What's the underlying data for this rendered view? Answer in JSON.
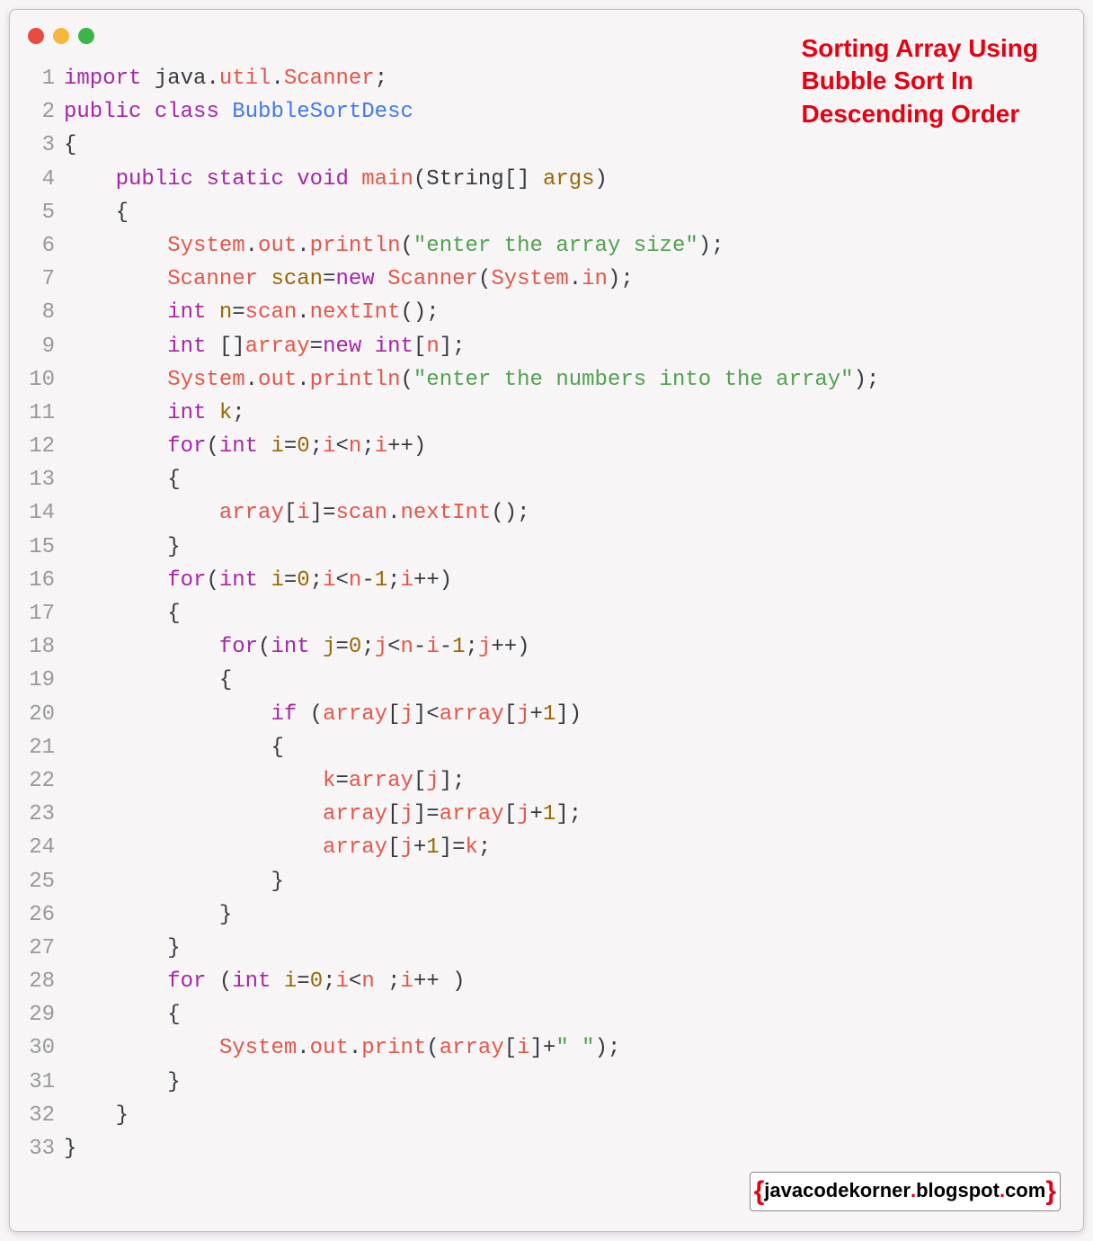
{
  "title": "Sorting Array Using\nBubble Sort In\nDescending Order",
  "footer": {
    "leftBrace": "{",
    "domain": "javacodekorner",
    "dot": ".",
    "suffix": "blogspot",
    "dot2": ".",
    "tld": "com",
    "rightBrace": "}"
  },
  "lines": [
    {
      "num": "1",
      "segments": [
        {
          "c": "kw-purple",
          "t": "import"
        },
        {
          "c": "txt-black",
          "t": " java"
        },
        {
          "c": "punct",
          "t": "."
        },
        {
          "c": "var-red",
          "t": "util"
        },
        {
          "c": "punct",
          "t": "."
        },
        {
          "c": "var-red",
          "t": "Scanner"
        },
        {
          "c": "punct",
          "t": ";"
        }
      ]
    },
    {
      "num": "2",
      "segments": [
        {
          "c": "kw-purple",
          "t": "public"
        },
        {
          "c": "txt-black",
          "t": " "
        },
        {
          "c": "kw-purple",
          "t": "class"
        },
        {
          "c": "txt-black",
          "t": " "
        },
        {
          "c": "cls-name",
          "t": "BubbleSortDesc"
        }
      ]
    },
    {
      "num": "3",
      "segments": [
        {
          "c": "punct",
          "t": "{"
        }
      ]
    },
    {
      "num": "4",
      "segments": [
        {
          "c": "txt-black",
          "t": "    "
        },
        {
          "c": "kw-purple",
          "t": "public"
        },
        {
          "c": "txt-black",
          "t": " "
        },
        {
          "c": "kw-purple",
          "t": "static"
        },
        {
          "c": "txt-black",
          "t": " "
        },
        {
          "c": "kw-purple",
          "t": "void"
        },
        {
          "c": "txt-black",
          "t": " "
        },
        {
          "c": "method-red",
          "t": "main"
        },
        {
          "c": "punct",
          "t": "("
        },
        {
          "c": "txt-black",
          "t": "String"
        },
        {
          "c": "punct",
          "t": "[] "
        },
        {
          "c": "ident",
          "t": "args"
        },
        {
          "c": "punct",
          "t": ")"
        }
      ]
    },
    {
      "num": "5",
      "segments": [
        {
          "c": "txt-black",
          "t": "    "
        },
        {
          "c": "punct",
          "t": "{"
        }
      ]
    },
    {
      "num": "6",
      "segments": [
        {
          "c": "txt-black",
          "t": "        "
        },
        {
          "c": "var-red",
          "t": "System"
        },
        {
          "c": "punct",
          "t": "."
        },
        {
          "c": "var-red",
          "t": "out"
        },
        {
          "c": "punct",
          "t": "."
        },
        {
          "c": "var-red",
          "t": "println"
        },
        {
          "c": "punct",
          "t": "("
        },
        {
          "c": "str-green",
          "t": "\"enter the array size\""
        },
        {
          "c": "punct",
          "t": ");"
        }
      ]
    },
    {
      "num": "7",
      "segments": [
        {
          "c": "txt-black",
          "t": "        "
        },
        {
          "c": "var-red",
          "t": "Scanner"
        },
        {
          "c": "txt-black",
          "t": " "
        },
        {
          "c": "ident",
          "t": "scan"
        },
        {
          "c": "punct",
          "t": "="
        },
        {
          "c": "kw-purple",
          "t": "new"
        },
        {
          "c": "txt-black",
          "t": " "
        },
        {
          "c": "var-red",
          "t": "Scanner"
        },
        {
          "c": "punct",
          "t": "("
        },
        {
          "c": "var-red",
          "t": "System"
        },
        {
          "c": "punct",
          "t": "."
        },
        {
          "c": "var-red",
          "t": "in"
        },
        {
          "c": "punct",
          "t": ");"
        }
      ]
    },
    {
      "num": "8",
      "segments": [
        {
          "c": "txt-black",
          "t": "        "
        },
        {
          "c": "kw-purple",
          "t": "int"
        },
        {
          "c": "txt-black",
          "t": " "
        },
        {
          "c": "ident",
          "t": "n"
        },
        {
          "c": "punct",
          "t": "="
        },
        {
          "c": "var-red",
          "t": "scan"
        },
        {
          "c": "punct",
          "t": "."
        },
        {
          "c": "var-red",
          "t": "nextInt"
        },
        {
          "c": "punct",
          "t": "();"
        }
      ]
    },
    {
      "num": "9",
      "segments": [
        {
          "c": "txt-black",
          "t": "        "
        },
        {
          "c": "kw-purple",
          "t": "int"
        },
        {
          "c": "txt-black",
          "t": " "
        },
        {
          "c": "punct",
          "t": "[]"
        },
        {
          "c": "var-red",
          "t": "array"
        },
        {
          "c": "punct",
          "t": "="
        },
        {
          "c": "kw-purple",
          "t": "new"
        },
        {
          "c": "txt-black",
          "t": " "
        },
        {
          "c": "kw-purple",
          "t": "int"
        },
        {
          "c": "punct",
          "t": "["
        },
        {
          "c": "var-red",
          "t": "n"
        },
        {
          "c": "punct",
          "t": "];"
        }
      ]
    },
    {
      "num": "10",
      "segments": [
        {
          "c": "txt-black",
          "t": "        "
        },
        {
          "c": "var-red",
          "t": "System"
        },
        {
          "c": "punct",
          "t": "."
        },
        {
          "c": "var-red",
          "t": "out"
        },
        {
          "c": "punct",
          "t": "."
        },
        {
          "c": "var-red",
          "t": "println"
        },
        {
          "c": "punct",
          "t": "("
        },
        {
          "c": "str-green",
          "t": "\"enter the numbers into the array\""
        },
        {
          "c": "punct",
          "t": ");"
        }
      ]
    },
    {
      "num": "11",
      "segments": [
        {
          "c": "txt-black",
          "t": "        "
        },
        {
          "c": "kw-purple",
          "t": "int"
        },
        {
          "c": "txt-black",
          "t": " "
        },
        {
          "c": "ident",
          "t": "k"
        },
        {
          "c": "punct",
          "t": ";"
        }
      ]
    },
    {
      "num": "12",
      "segments": [
        {
          "c": "txt-black",
          "t": "        "
        },
        {
          "c": "kw-purple",
          "t": "for"
        },
        {
          "c": "punct",
          "t": "("
        },
        {
          "c": "kw-purple",
          "t": "int"
        },
        {
          "c": "txt-black",
          "t": " "
        },
        {
          "c": "ident",
          "t": "i"
        },
        {
          "c": "punct",
          "t": "="
        },
        {
          "c": "num-orange",
          "t": "0"
        },
        {
          "c": "punct",
          "t": ";"
        },
        {
          "c": "var-red",
          "t": "i"
        },
        {
          "c": "punct",
          "t": "<"
        },
        {
          "c": "var-red",
          "t": "n"
        },
        {
          "c": "punct",
          "t": ";"
        },
        {
          "c": "var-red",
          "t": "i"
        },
        {
          "c": "punct",
          "t": "++)"
        }
      ]
    },
    {
      "num": "13",
      "segments": [
        {
          "c": "txt-black",
          "t": "        "
        },
        {
          "c": "punct",
          "t": "{"
        }
      ]
    },
    {
      "num": "14",
      "segments": [
        {
          "c": "txt-black",
          "t": "            "
        },
        {
          "c": "var-red",
          "t": "array"
        },
        {
          "c": "punct",
          "t": "["
        },
        {
          "c": "var-red",
          "t": "i"
        },
        {
          "c": "punct",
          "t": "]="
        },
        {
          "c": "var-red",
          "t": "scan"
        },
        {
          "c": "punct",
          "t": "."
        },
        {
          "c": "var-red",
          "t": "nextInt"
        },
        {
          "c": "punct",
          "t": "();"
        }
      ]
    },
    {
      "num": "15",
      "segments": [
        {
          "c": "txt-black",
          "t": "        "
        },
        {
          "c": "punct",
          "t": "}"
        }
      ]
    },
    {
      "num": "16",
      "segments": [
        {
          "c": "txt-black",
          "t": "        "
        },
        {
          "c": "kw-purple",
          "t": "for"
        },
        {
          "c": "punct",
          "t": "("
        },
        {
          "c": "kw-purple",
          "t": "int"
        },
        {
          "c": "txt-black",
          "t": " "
        },
        {
          "c": "ident",
          "t": "i"
        },
        {
          "c": "punct",
          "t": "="
        },
        {
          "c": "num-orange",
          "t": "0"
        },
        {
          "c": "punct",
          "t": ";"
        },
        {
          "c": "var-red",
          "t": "i"
        },
        {
          "c": "punct",
          "t": "<"
        },
        {
          "c": "var-red",
          "t": "n"
        },
        {
          "c": "punct",
          "t": "-"
        },
        {
          "c": "num-orange",
          "t": "1"
        },
        {
          "c": "punct",
          "t": ";"
        },
        {
          "c": "var-red",
          "t": "i"
        },
        {
          "c": "punct",
          "t": "++)"
        }
      ]
    },
    {
      "num": "17",
      "segments": [
        {
          "c": "txt-black",
          "t": "        "
        },
        {
          "c": "punct",
          "t": "{"
        }
      ]
    },
    {
      "num": "18",
      "segments": [
        {
          "c": "txt-black",
          "t": "            "
        },
        {
          "c": "kw-purple",
          "t": "for"
        },
        {
          "c": "punct",
          "t": "("
        },
        {
          "c": "kw-purple",
          "t": "int"
        },
        {
          "c": "txt-black",
          "t": " "
        },
        {
          "c": "ident",
          "t": "j"
        },
        {
          "c": "punct",
          "t": "="
        },
        {
          "c": "num-orange",
          "t": "0"
        },
        {
          "c": "punct",
          "t": ";"
        },
        {
          "c": "var-red",
          "t": "j"
        },
        {
          "c": "punct",
          "t": "<"
        },
        {
          "c": "var-red",
          "t": "n"
        },
        {
          "c": "punct",
          "t": "-"
        },
        {
          "c": "var-red",
          "t": "i"
        },
        {
          "c": "punct",
          "t": "-"
        },
        {
          "c": "num-orange",
          "t": "1"
        },
        {
          "c": "punct",
          "t": ";"
        },
        {
          "c": "var-red",
          "t": "j"
        },
        {
          "c": "punct",
          "t": "++)"
        }
      ]
    },
    {
      "num": "19",
      "segments": [
        {
          "c": "txt-black",
          "t": "            "
        },
        {
          "c": "punct",
          "t": "{"
        }
      ]
    },
    {
      "num": "20",
      "segments": [
        {
          "c": "txt-black",
          "t": "                "
        },
        {
          "c": "kw-purple",
          "t": "if"
        },
        {
          "c": "txt-black",
          "t": " "
        },
        {
          "c": "punct",
          "t": "("
        },
        {
          "c": "var-red",
          "t": "array"
        },
        {
          "c": "punct",
          "t": "["
        },
        {
          "c": "var-red",
          "t": "j"
        },
        {
          "c": "punct",
          "t": "]<"
        },
        {
          "c": "var-red",
          "t": "array"
        },
        {
          "c": "punct",
          "t": "["
        },
        {
          "c": "var-red",
          "t": "j"
        },
        {
          "c": "punct",
          "t": "+"
        },
        {
          "c": "num-orange",
          "t": "1"
        },
        {
          "c": "punct",
          "t": "])"
        }
      ]
    },
    {
      "num": "21",
      "segments": [
        {
          "c": "txt-black",
          "t": "                "
        },
        {
          "c": "punct",
          "t": "{"
        }
      ]
    },
    {
      "num": "22",
      "segments": [
        {
          "c": "txt-black",
          "t": "                    "
        },
        {
          "c": "var-red",
          "t": "k"
        },
        {
          "c": "punct",
          "t": "="
        },
        {
          "c": "var-red",
          "t": "array"
        },
        {
          "c": "punct",
          "t": "["
        },
        {
          "c": "var-red",
          "t": "j"
        },
        {
          "c": "punct",
          "t": "];"
        }
      ]
    },
    {
      "num": "23",
      "segments": [
        {
          "c": "txt-black",
          "t": "                    "
        },
        {
          "c": "var-red",
          "t": "array"
        },
        {
          "c": "punct",
          "t": "["
        },
        {
          "c": "var-red",
          "t": "j"
        },
        {
          "c": "punct",
          "t": "]="
        },
        {
          "c": "var-red",
          "t": "array"
        },
        {
          "c": "punct",
          "t": "["
        },
        {
          "c": "var-red",
          "t": "j"
        },
        {
          "c": "punct",
          "t": "+"
        },
        {
          "c": "num-orange",
          "t": "1"
        },
        {
          "c": "punct",
          "t": "];"
        }
      ]
    },
    {
      "num": "24",
      "segments": [
        {
          "c": "txt-black",
          "t": "                    "
        },
        {
          "c": "var-red",
          "t": "array"
        },
        {
          "c": "punct",
          "t": "["
        },
        {
          "c": "var-red",
          "t": "j"
        },
        {
          "c": "punct",
          "t": "+"
        },
        {
          "c": "num-orange",
          "t": "1"
        },
        {
          "c": "punct",
          "t": "]="
        },
        {
          "c": "var-red",
          "t": "k"
        },
        {
          "c": "punct",
          "t": ";"
        }
      ]
    },
    {
      "num": "25",
      "segments": [
        {
          "c": "txt-black",
          "t": "                "
        },
        {
          "c": "punct",
          "t": "}"
        }
      ]
    },
    {
      "num": "26",
      "segments": [
        {
          "c": "txt-black",
          "t": "            "
        },
        {
          "c": "punct",
          "t": "}"
        }
      ]
    },
    {
      "num": "27",
      "segments": [
        {
          "c": "txt-black",
          "t": "        "
        },
        {
          "c": "punct",
          "t": "}"
        }
      ]
    },
    {
      "num": "28",
      "segments": [
        {
          "c": "txt-black",
          "t": "        "
        },
        {
          "c": "kw-purple",
          "t": "for"
        },
        {
          "c": "txt-black",
          "t": " "
        },
        {
          "c": "punct",
          "t": "("
        },
        {
          "c": "kw-purple",
          "t": "int"
        },
        {
          "c": "txt-black",
          "t": " "
        },
        {
          "c": "ident",
          "t": "i"
        },
        {
          "c": "punct",
          "t": "="
        },
        {
          "c": "num-orange",
          "t": "0"
        },
        {
          "c": "punct",
          "t": ";"
        },
        {
          "c": "var-red",
          "t": "i"
        },
        {
          "c": "punct",
          "t": "<"
        },
        {
          "c": "var-red",
          "t": "n"
        },
        {
          "c": "txt-black",
          "t": " "
        },
        {
          "c": "punct",
          "t": ";"
        },
        {
          "c": "var-red",
          "t": "i"
        },
        {
          "c": "punct",
          "t": "++ )"
        }
      ]
    },
    {
      "num": "29",
      "segments": [
        {
          "c": "txt-black",
          "t": "        "
        },
        {
          "c": "punct",
          "t": "{"
        }
      ]
    },
    {
      "num": "30",
      "segments": [
        {
          "c": "txt-black",
          "t": "            "
        },
        {
          "c": "var-red",
          "t": "System"
        },
        {
          "c": "punct",
          "t": "."
        },
        {
          "c": "var-red",
          "t": "out"
        },
        {
          "c": "punct",
          "t": "."
        },
        {
          "c": "var-red",
          "t": "print"
        },
        {
          "c": "punct",
          "t": "("
        },
        {
          "c": "var-red",
          "t": "array"
        },
        {
          "c": "punct",
          "t": "["
        },
        {
          "c": "var-red",
          "t": "i"
        },
        {
          "c": "punct",
          "t": "]+"
        },
        {
          "c": "str-green",
          "t": "\" \""
        },
        {
          "c": "punct",
          "t": ");"
        }
      ]
    },
    {
      "num": "31",
      "segments": [
        {
          "c": "txt-black",
          "t": "        "
        },
        {
          "c": "punct",
          "t": "}"
        }
      ]
    },
    {
      "num": "32",
      "segments": [
        {
          "c": "txt-black",
          "t": "    "
        },
        {
          "c": "punct",
          "t": "}"
        }
      ]
    },
    {
      "num": "33",
      "segments": [
        {
          "c": "punct",
          "t": "}"
        }
      ]
    }
  ]
}
